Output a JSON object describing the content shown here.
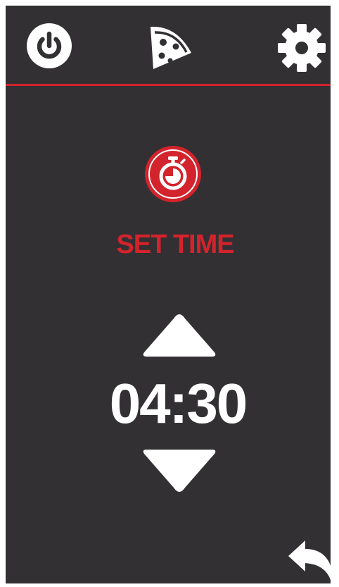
{
  "topbar": {
    "icons": [
      "power-icon",
      "pizza-icon",
      "gear-icon"
    ]
  },
  "mode": {
    "icon": "stopwatch-icon",
    "label": "SET TIME"
  },
  "timer": {
    "value": "04:30"
  },
  "controls": {
    "increase_icon": "triangle-up-icon",
    "decrease_icon": "triangle-down-icon",
    "back_icon": "back-arrow-icon"
  },
  "colors": {
    "background": "#323033",
    "accent": "#d3232c",
    "foreground": "#ffffff"
  }
}
